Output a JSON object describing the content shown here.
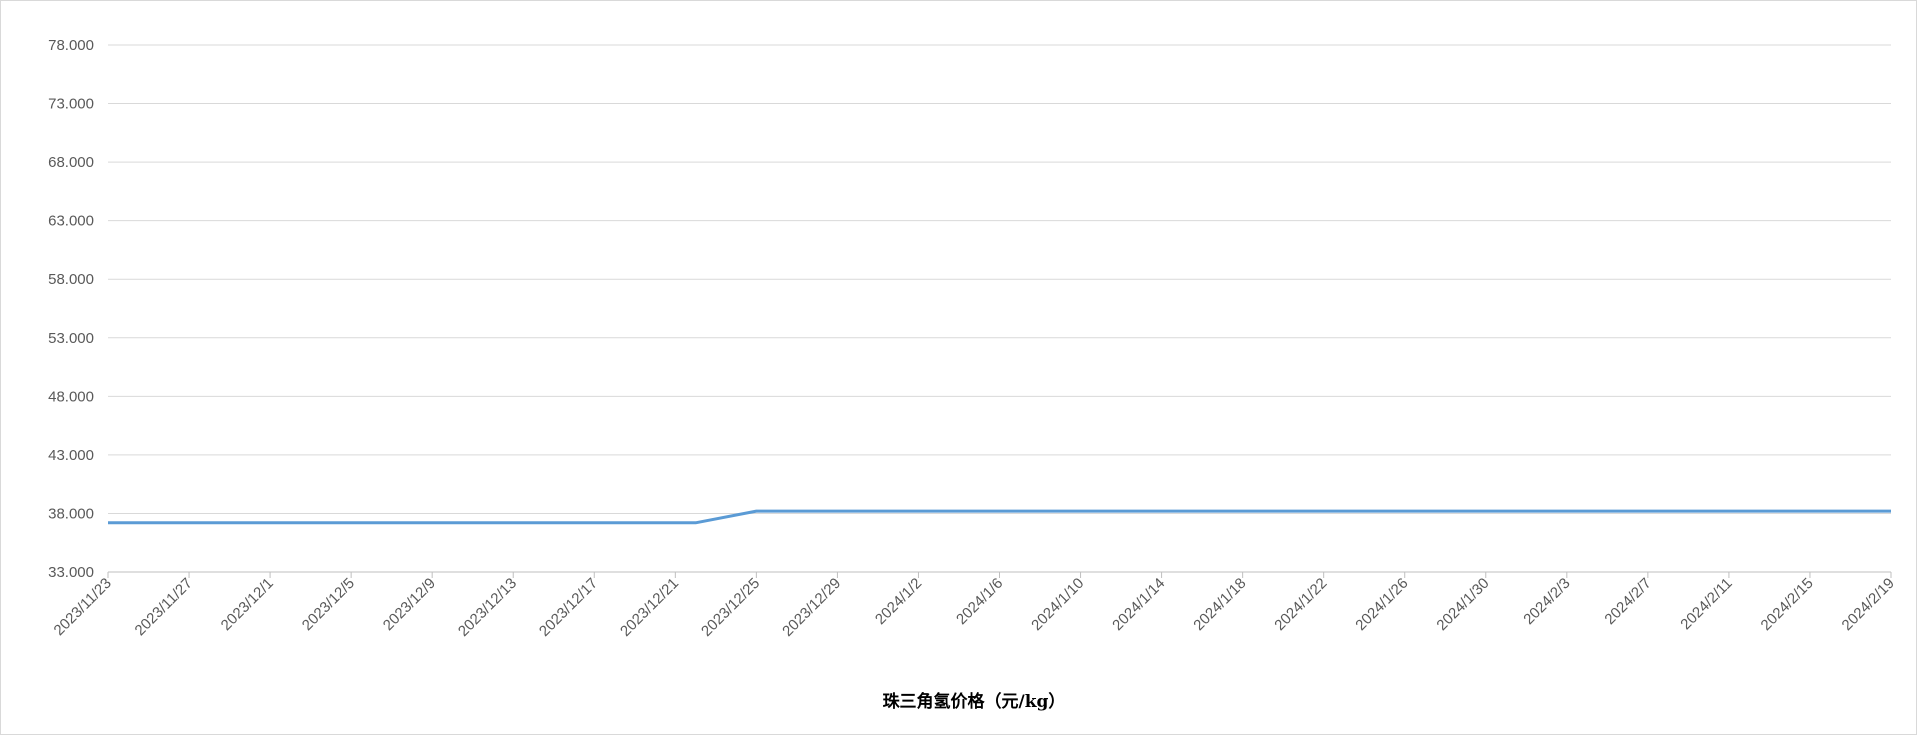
{
  "chart_data": {
    "type": "line",
    "title": "",
    "xlabel": "珠三角氢价格（元/kg）",
    "ylabel": "",
    "ylim": [
      33,
      78
    ],
    "y_ticks": [
      "33.000",
      "38.000",
      "43.000",
      "48.000",
      "53.000",
      "58.000",
      "63.000",
      "68.000",
      "73.000",
      "78.000"
    ],
    "x_tick_labels": [
      "2023/11/23",
      "2023/11/27",
      "2023/12/1",
      "2023/12/5",
      "2023/12/9",
      "2023/12/13",
      "2023/12/17",
      "2023/12/21",
      "2023/12/25",
      "2023/12/29",
      "2024/1/2",
      "2024/1/6",
      "2024/1/10",
      "2024/1/14",
      "2024/1/18",
      "2024/1/22",
      "2024/1/26",
      "2024/1/30",
      "2024/2/3",
      "2024/2/7",
      "2024/2/11",
      "2024/2/15",
      "2024/2/19"
    ],
    "x_range": [
      "2023/11/23",
      "2024/2/19"
    ],
    "grid": true,
    "legend": "none",
    "series": [
      {
        "color": "#5b9bd5",
        "points": [
          {
            "x": "2023/11/23",
            "y": 37.2
          },
          {
            "x": "2023/12/22",
            "y": 37.2
          },
          {
            "x": "2023/12/25",
            "y": 38.2
          },
          {
            "x": "2024/2/19",
            "y": 38.2
          }
        ]
      }
    ]
  }
}
